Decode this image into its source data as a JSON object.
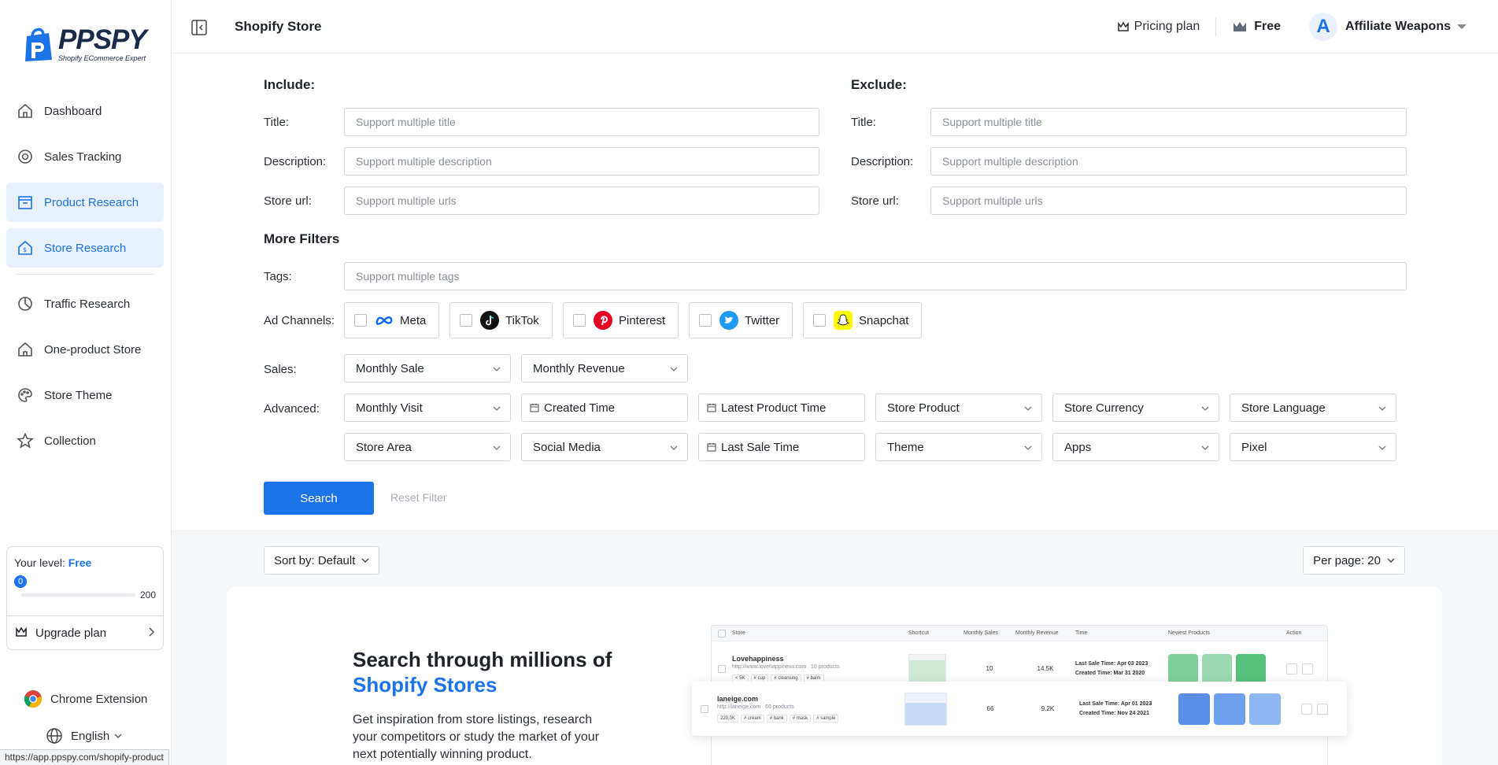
{
  "app": {
    "brand": "PPSPY",
    "brand_sub": "Shopify ECommerce Expert",
    "page_title": "Shopify Store"
  },
  "sidebar": {
    "items": [
      {
        "label": "Dashboard",
        "icon": "home-icon"
      },
      {
        "label": "Sales Tracking",
        "icon": "target-icon"
      },
      {
        "label": "Product Research",
        "icon": "box-icon"
      },
      {
        "label": "Store Research",
        "icon": "store-dollar-icon"
      },
      {
        "label": "Traffic Research",
        "icon": "pie-icon"
      },
      {
        "label": "One-product Store",
        "icon": "house-icon"
      },
      {
        "label": "Store Theme",
        "icon": "palette-icon"
      },
      {
        "label": "Collection",
        "icon": "star-icon"
      }
    ],
    "level": {
      "label": "Your level:",
      "value": "Free",
      "current": "0",
      "max": "200",
      "progress": 0
    },
    "upgrade_label": "Upgrade plan",
    "chrome_extension": "Chrome Extension",
    "language": "English"
  },
  "header": {
    "pricing": "Pricing plan",
    "plan": "Free",
    "avatar_letter": "A",
    "username": "Affiliate Weapons"
  },
  "filters": {
    "include_title": "Include:",
    "exclude_title": "Exclude:",
    "title_label": "Title:",
    "description_label": "Description:",
    "store_url_label": "Store url:",
    "title_placeholder": "Support multiple title",
    "description_placeholder": "Support multiple description",
    "urls_placeholder": "Support multiple urls",
    "more_filters": "More Filters",
    "tags_label": "Tags:",
    "tags_placeholder": "Support multiple tags",
    "ad_channels_label": "Ad Channels:",
    "channels": [
      "Meta",
      "TikTok",
      "Pinterest",
      "Twitter",
      "Snapchat"
    ],
    "sales_label": "Sales:",
    "sales": [
      "Monthly Sale",
      "Monthly Revenue"
    ],
    "advanced_label": "Advanced:",
    "advanced_row1": [
      "Monthly Visit",
      "Created Time",
      "Latest Product Time",
      "Store Product",
      "Store Currency",
      "Store Language"
    ],
    "advanced_row2": [
      "Store Area",
      "Social Media",
      "Last Sale Time",
      "Theme",
      "Apps",
      "Pixel"
    ],
    "search": "Search",
    "reset": "Reset Filter"
  },
  "results": {
    "sort": "Sort by: Default",
    "per_page": "Per page: 20",
    "promo_line1": "Search through millions of",
    "promo_line2": "Shopify Stores",
    "promo_text": "Get inspiration from store listings, research your competitors or study the market of your next potentially winning product.",
    "mock_headers": [
      "Store",
      "Shortcut",
      "Monthly Sales",
      "Monthly Revenue",
      "Time",
      "Newest Products",
      "Action"
    ],
    "mock_rows": [
      {
        "name": "Lovehappiness",
        "url": "http://www.lovehappiness.com",
        "products": "10 products",
        "tags": [
          "< 5K",
          "# cup",
          "# cleansing",
          "# balm"
        ],
        "sales": "10",
        "revenue": "14.5K",
        "last_sale": "Last Sale Time: Apr 03 2023",
        "created": "Created Time: Mar 31 2020",
        "colors": [
          "#7fcf9a",
          "#9ad9b0",
          "#58c27d"
        ]
      },
      {
        "name": "laneige.com",
        "url": "http://laneige.com",
        "products": "66 products",
        "tags": [
          "220.0K",
          "# cream",
          "# bank",
          "# mask",
          "# sample"
        ],
        "sales": "66",
        "revenue": "9.2K",
        "last_sale": "Last Sale Time: Apr 01 2023",
        "created": "Created Time: Nov 24 2021",
        "colors": [
          "#5b8fe6",
          "#6fa0ee",
          "#8db6f2"
        ]
      }
    ]
  },
  "status_url": "https://app.ppspy.com/shopify-product",
  "colors": {
    "accent": "#1a73e8",
    "active_bg": "#e8f1fd"
  }
}
